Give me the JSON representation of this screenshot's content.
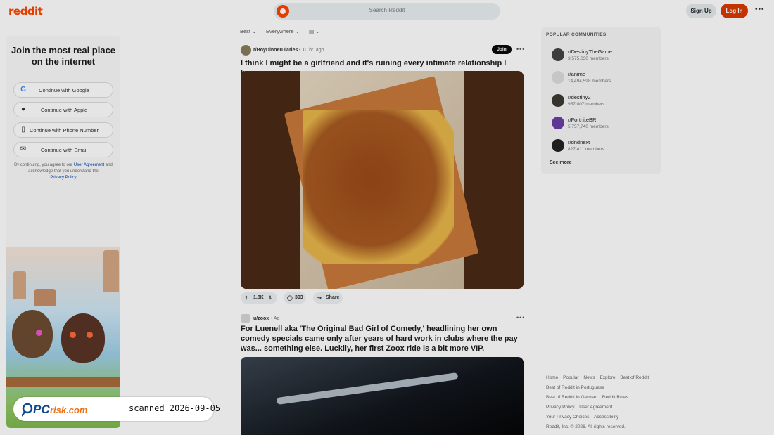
{
  "header": {
    "logo": "reddit",
    "search_placeholder": "Search Reddit",
    "signup_label": "Sign Up",
    "login_label": "Log In",
    "more_icon": "ellipsis-icon",
    "brand_color": "#ff4500"
  },
  "left_panel": {
    "title": "Join the most real place on the internet",
    "buttons": [
      {
        "label": "Continue with Google",
        "icon": "google-icon"
      },
      {
        "label": "Continue with Apple",
        "icon": "apple-icon"
      },
      {
        "label": "Continue with Phone Number",
        "icon": "phone-icon"
      },
      {
        "label": "Continue with Email",
        "icon": "email-icon"
      }
    ],
    "terms_prefix": "By continuing, you agree to our",
    "terms_link": "User Agreement",
    "terms_middle": "and acknowledge that you understand the",
    "privacy_link": "Privacy Policy"
  },
  "feed": {
    "filters": [
      "Best",
      "Everywhere",
      "view-icon"
    ],
    "post1": {
      "subreddit": "r/BoyDinnerDiaries",
      "time": "10 hr. ago",
      "join_label": "Join",
      "title": "I think I might be a girlfriend and it's ruining every intimate relationship I have.",
      "votes": "1.8K",
      "comments": "393",
      "share_label": "Share"
    },
    "post2": {
      "author": "u/zoox",
      "tag": "Ad",
      "title": "For Luenell aka 'The Original Bad Girl of Comedy,' headlining her own comedy specials came only after years of hard work in clubs where the pay was... something else. Luckily, her first Zoox ride is a bit more VIP."
    }
  },
  "right_panel": {
    "title": "POPULAR COMMUNITIES",
    "communities": [
      {
        "name": "r/DestinyTheGame",
        "members": "3,575,030 members"
      },
      {
        "name": "r/anime",
        "members": "14,494,598 members"
      },
      {
        "name": "r/destiny2",
        "members": "957,007 members"
      },
      {
        "name": "r/FortniteBR",
        "members": "5,757,740 members"
      },
      {
        "name": "r/dndnext",
        "members": "827,411 members"
      }
    ],
    "see_more": "See more"
  },
  "footer": {
    "rows": [
      [
        "Home",
        "Popular",
        "News",
        "Explore",
        "Best of Reddit"
      ],
      [
        "Best of Reddit in Portuguese"
      ],
      [
        "Best of Reddit in German",
        "Reddit Rules"
      ],
      [
        "Privacy Policy",
        "User Agreement"
      ],
      [
        "Your Privacy Choices",
        "Accessibility"
      ],
      [
        "Reddit, Inc. © 2026. All rights reserved."
      ]
    ]
  },
  "watermark": {
    "logo_text": "PCrisk.com",
    "scan_text": "scanned 2026-09-05"
  }
}
